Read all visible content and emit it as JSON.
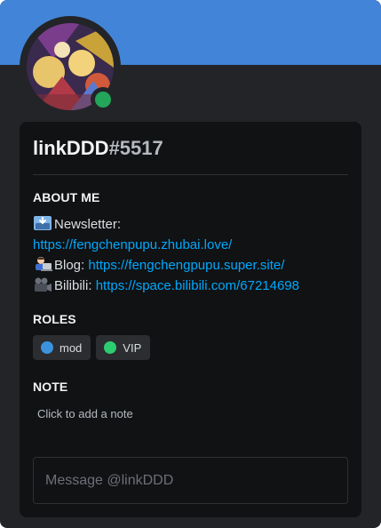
{
  "profile": {
    "banner_color": "#4285d8",
    "status": "online",
    "status_color": "#23a55a",
    "username": "linkDDD",
    "discriminator": "#5517"
  },
  "about": {
    "title": "ABOUT ME",
    "newsletter_label": "Newsletter:",
    "newsletter_url": "https://fengchenpupu.zhubai.love/",
    "blog_label": "Blog:",
    "blog_url": "https://fengchengpupu.super.site/",
    "bilibili_label": "Bilibili:",
    "bilibili_url": "https://space.bilibili.com/67214698"
  },
  "roles": {
    "title": "ROLES",
    "items": [
      {
        "name": "mod",
        "color": "#3b93de"
      },
      {
        "name": "VIP",
        "color": "#2ecc71"
      }
    ]
  },
  "note": {
    "title": "NOTE",
    "placeholder": "Click to add a note"
  },
  "message": {
    "placeholder": "Message @linkDDD"
  }
}
